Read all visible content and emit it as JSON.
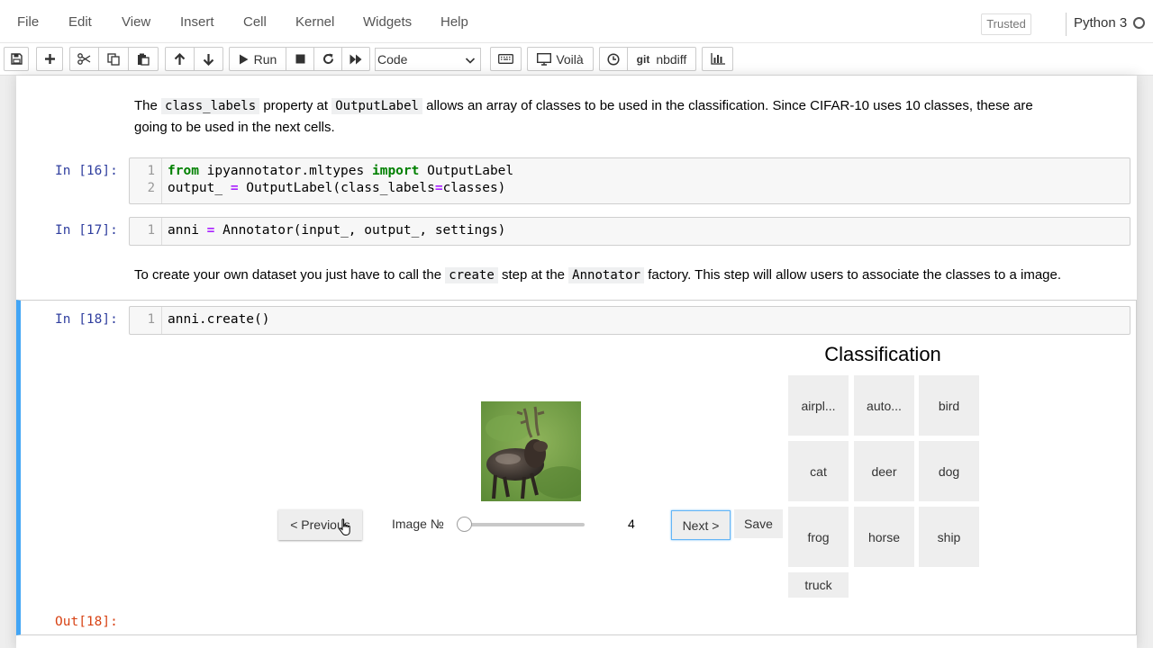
{
  "menubar": {
    "items": [
      "File",
      "Edit",
      "View",
      "Insert",
      "Cell",
      "Kernel",
      "Widgets",
      "Help"
    ],
    "trusted_label": "Trusted",
    "kernel_name": "Python 3"
  },
  "toolbar": {
    "run_label": "Run",
    "cell_type": "Code",
    "voila_label": "Voilà",
    "git_label": "git",
    "nbdiff_label": "nbdiff"
  },
  "markdown_1": {
    "part1": "The ",
    "code1": "class_labels",
    "part2": " property at ",
    "code2": "OutputLabel",
    "part3": " allows an array of classes to be used in the classification. Since CIFAR-10 uses 10 classes, these are",
    "line2": "going to be used in the next cells."
  },
  "cell_16": {
    "prompt": "In [16]:",
    "line1_num": "1",
    "line1_kw1": "from",
    "line1_mod": " ipyannotator.mltypes ",
    "line1_kw2": "import",
    "line1_name": " OutputLabel",
    "line2_num": "2",
    "line2_a": "output_ ",
    "line2_op1": "=",
    "line2_b": " OutputLabel(class_labels",
    "line2_op2": "=",
    "line2_c": "classes)"
  },
  "cell_17": {
    "prompt": "In [17]:",
    "line1_num": "1",
    "line1_a": "anni ",
    "line1_op": "=",
    "line1_b": " Annotator(input_, output_, settings)"
  },
  "markdown_2": {
    "part1": "To create your own dataset you just have to call the ",
    "code1": "create",
    "part2": " step at the ",
    "code2": "Annotator",
    "part3": " factory. This step will allow users to associate the classes to a image."
  },
  "cell_18": {
    "prompt": "In [18]:",
    "line1_num": "1",
    "line1": "anni.create()",
    "out_prompt": "Out[18]:"
  },
  "widget": {
    "title": "Classification",
    "previous_label": "< Previous",
    "image_label": "Image №",
    "image_index": "4",
    "slider_fraction": 0,
    "next_label": "Next >",
    "save_label": "Save",
    "image_description": "deer",
    "classes": [
      "airpl...",
      "auto...",
      "bird",
      "cat",
      "deer",
      "dog",
      "frog",
      "horse",
      "ship",
      "truck"
    ]
  },
  "colors": {
    "prompt_in": "#303f9f",
    "prompt_out": "#d84315",
    "selected_cell_border": "#42a5f5",
    "keyword": "#008000",
    "operator": "#aa22ff"
  }
}
